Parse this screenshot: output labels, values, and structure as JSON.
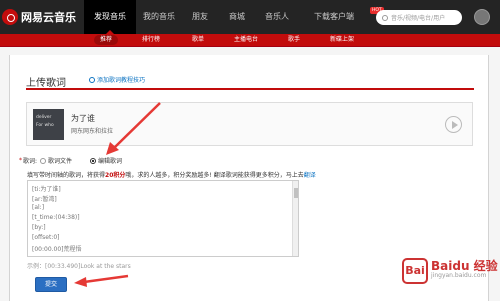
{
  "brand": {
    "name": "网易云音乐",
    "accent": "#c20c0c"
  },
  "topnav": [
    {
      "label": "发现音乐",
      "active": true
    },
    {
      "label": "我的音乐"
    },
    {
      "label": "朋友"
    },
    {
      "label": "商城"
    },
    {
      "label": "音乐人"
    },
    {
      "label": "下载客户端"
    }
  ],
  "hot_badge": "HOT",
  "search": {
    "placeholder": "音乐/视频/电台/用户"
  },
  "subnav": [
    {
      "label": "推荐",
      "active": true
    },
    {
      "label": "排行榜"
    },
    {
      "label": "歌单"
    },
    {
      "label": "主播电台"
    },
    {
      "label": "歌手"
    },
    {
      "label": "新碟上架"
    }
  ],
  "page": {
    "title": "上传歌词",
    "tips_link": "添加歌词教程技巧"
  },
  "song": {
    "cover_line1": "deliver",
    "cover_line2": "For who",
    "name": "为了谁",
    "artist": "网东网东和拉拉"
  },
  "lyric": {
    "label": "歌词:",
    "option_file": "歌词文件",
    "option_edit": "编辑歌词",
    "selected": "编辑歌词"
  },
  "instruction": {
    "pre": "填写带时间轴的歌词，将获得",
    "points": "20积分",
    "post": "哦，求的人越多，积分奖励越多! 翻译歌词能获得更多积分，马上去",
    "link": "翻译"
  },
  "textarea_lines": [
    "[ti:为了谁]",
    "[ar:暂湾]",
    "[al:]",
    "[t_time:(04:38)]",
    "[by:]",
    "[offset:0]",
    "[00:00.00]荒程悟"
  ],
  "example": "示例：[00:33.490]Look at the stars",
  "submit_label": "提交",
  "watermark": {
    "mark": "Bai",
    "big": "Baidu 经验",
    "small": "jingyan.baidu.com"
  }
}
